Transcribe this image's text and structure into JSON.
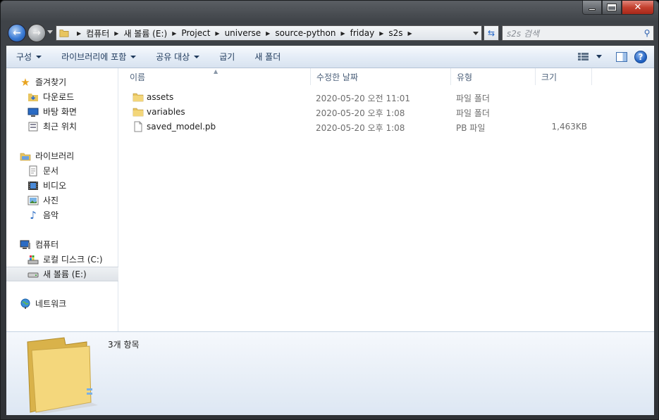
{
  "address": {
    "crumbs": [
      "컴퓨터",
      "새 볼륨 (E:)",
      "Project",
      "universe",
      "source-python",
      "friday",
      "s2s"
    ]
  },
  "search": {
    "placeholder": "s2s 검색"
  },
  "toolbar": {
    "organize": "구성",
    "include_library": "라이브러리에 포함",
    "share": "공유 대상",
    "burn": "굽기",
    "new_folder": "새 폴더"
  },
  "sidebar": {
    "favorites": {
      "label": "즐겨찾기",
      "items": [
        "다운로드",
        "바탕 화면",
        "최근 위치"
      ]
    },
    "libraries": {
      "label": "라이브러리",
      "items": [
        "문서",
        "비디오",
        "사진",
        "음악"
      ]
    },
    "computer": {
      "label": "컴퓨터",
      "items": [
        "로컬 디스크 (C:)",
        "새 볼륨 (E:)"
      ]
    },
    "network": {
      "label": "네트워크"
    }
  },
  "columns": {
    "name": "이름",
    "date": "수정한 날짜",
    "type": "유형",
    "size": "크기"
  },
  "files": [
    {
      "name": "assets",
      "date": "2020-05-20 오전 11:01",
      "type": "파일 폴더",
      "size": "",
      "icon": "folder-icon"
    },
    {
      "name": "variables",
      "date": "2020-05-20 오후 1:08",
      "type": "파일 폴더",
      "size": "",
      "icon": "folder-icon"
    },
    {
      "name": "saved_model.pb",
      "date": "2020-05-20 오후 1:08",
      "type": "PB 파일",
      "size": "1,463KB",
      "icon": "file-icon"
    }
  ],
  "details": {
    "count": "3개 항목"
  },
  "colors": {
    "toolbar_text": "#1e395b",
    "column_header": "#4c607a",
    "selection": "#dfe3e8"
  }
}
